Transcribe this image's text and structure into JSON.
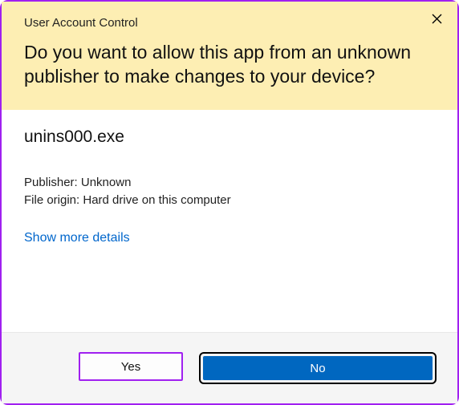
{
  "header": {
    "title": "User Account Control",
    "prompt": "Do you want to allow this app from an unknown publisher to make changes to your device?"
  },
  "content": {
    "program_name": "unins000.exe",
    "publisher_label": "Publisher:",
    "publisher_value": "Unknown",
    "origin_label": "File origin:",
    "origin_value": "Hard drive on this computer",
    "show_more": "Show more details"
  },
  "buttons": {
    "yes": "Yes",
    "no": "No"
  }
}
